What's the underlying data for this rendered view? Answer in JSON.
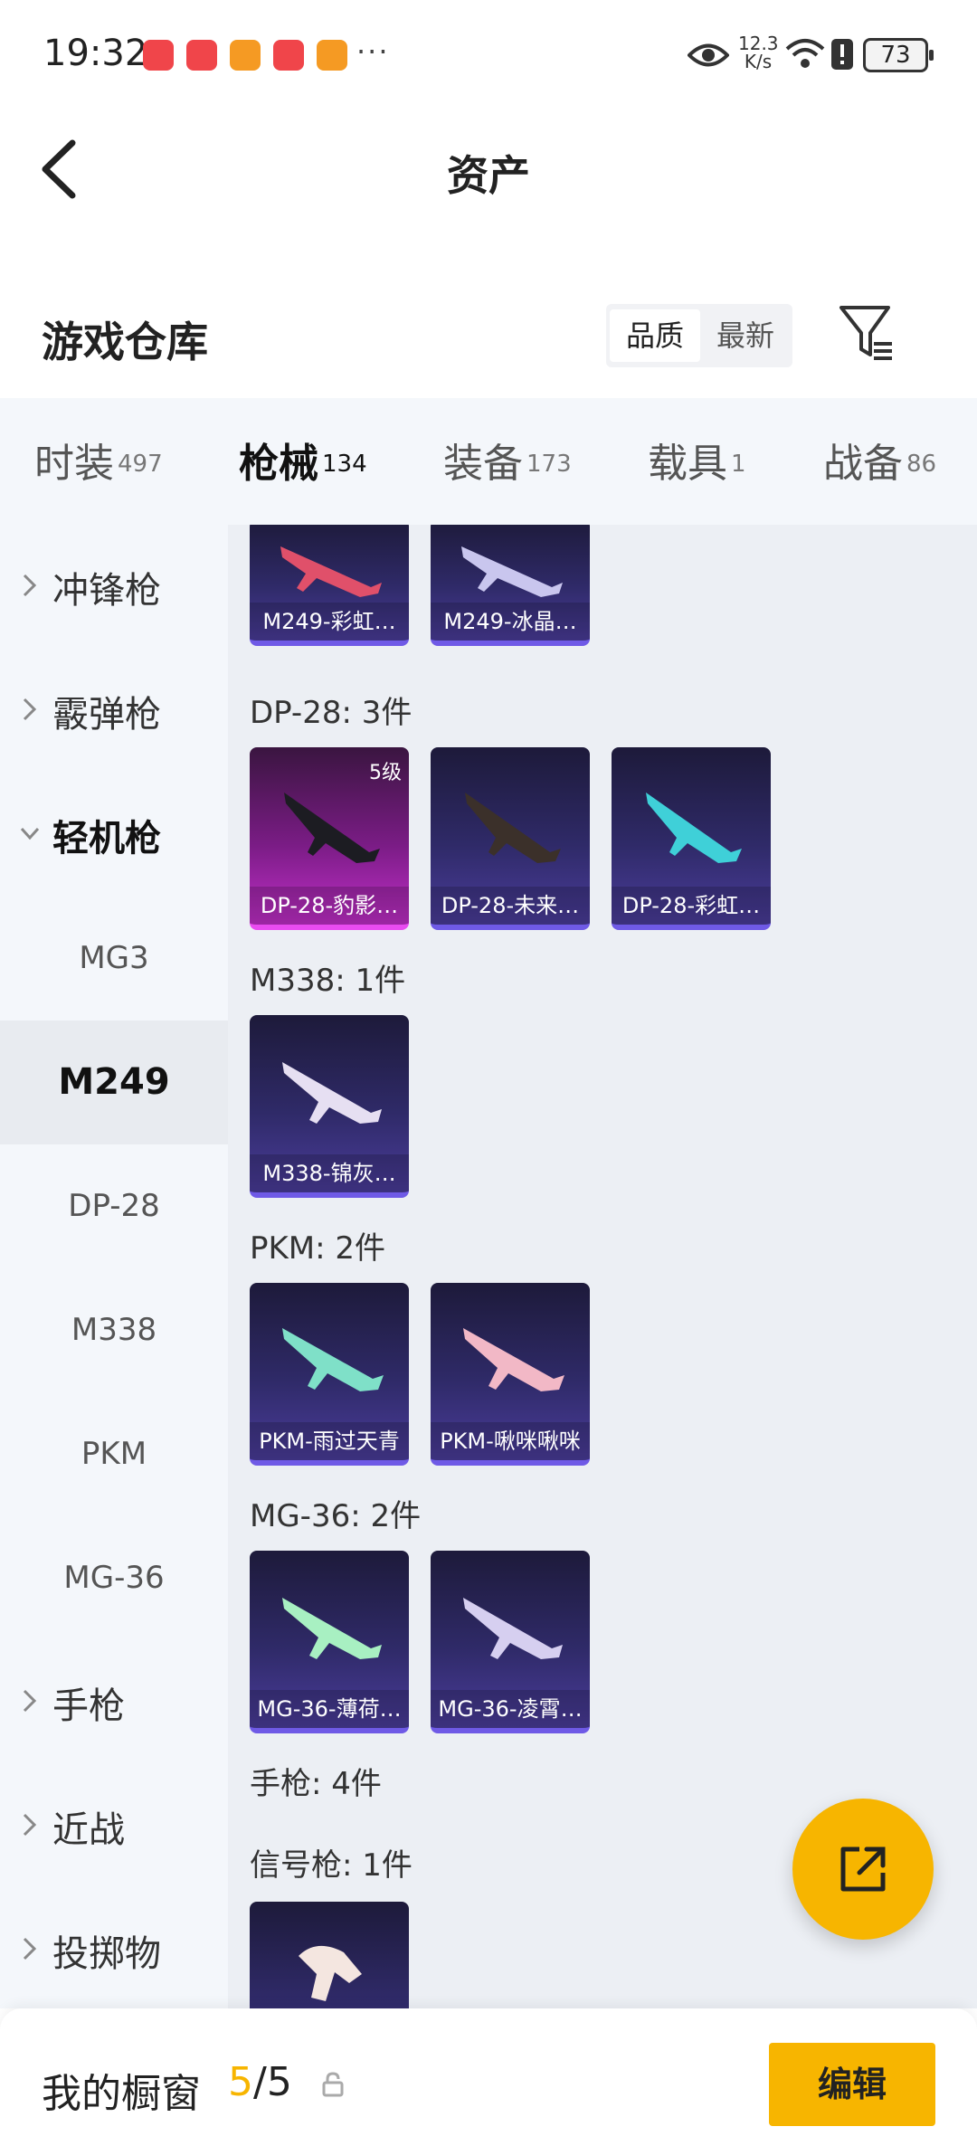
{
  "status": {
    "time": "19:32",
    "net_speed": "12.3\nK/s",
    "battery": "73",
    "more": "···"
  },
  "header": {
    "title": "资产"
  },
  "warehouse": {
    "title": "游戏仓库",
    "sort_quality": "品质",
    "sort_newest": "最新"
  },
  "tabs": [
    {
      "label": "时装",
      "count": "497"
    },
    {
      "label": "枪械",
      "count": "134"
    },
    {
      "label": "装备",
      "count": "173"
    },
    {
      "label": "载具",
      "count": "1"
    },
    {
      "label": "战备",
      "count": "86"
    }
  ],
  "sidebar": {
    "cats": [
      "冲锋枪",
      "霰弹枪",
      "轻机枪",
      "手枪",
      "近战",
      "投掷物"
    ],
    "subs": [
      "MG3",
      "M249",
      "DP-28",
      "M338",
      "PKM",
      "MG-36"
    ]
  },
  "content": {
    "m249_items": [
      "M249-彩虹…",
      "M249-冰晶…"
    ],
    "dp28_title": "DP-28: 3件",
    "dp28_items": [
      "DP-28-豹影…",
      "DP-28-未来…",
      "DP-28-彩虹…"
    ],
    "dp28_level": "5级",
    "m338_title": "M338: 1件",
    "m338_items": [
      "M338-锦灰…"
    ],
    "pkm_title": "PKM: 2件",
    "pkm_items": [
      "PKM-雨过天青",
      "PKM-啾咪啾咪"
    ],
    "mg36_title": "MG-36: 2件",
    "mg36_items": [
      "MG-36-薄荷…",
      "MG-36-凌霄…"
    ],
    "pistol_title": "手枪: 4件",
    "flare_title": "信号枪: 1件"
  },
  "bottom": {
    "title": "我的橱窗",
    "current": "5",
    "total": "/5",
    "edit": "编辑"
  },
  "colors": {
    "accent": "#f7b500",
    "card_purple": "#2f2a68",
    "card_pink": "#c02fc8"
  }
}
